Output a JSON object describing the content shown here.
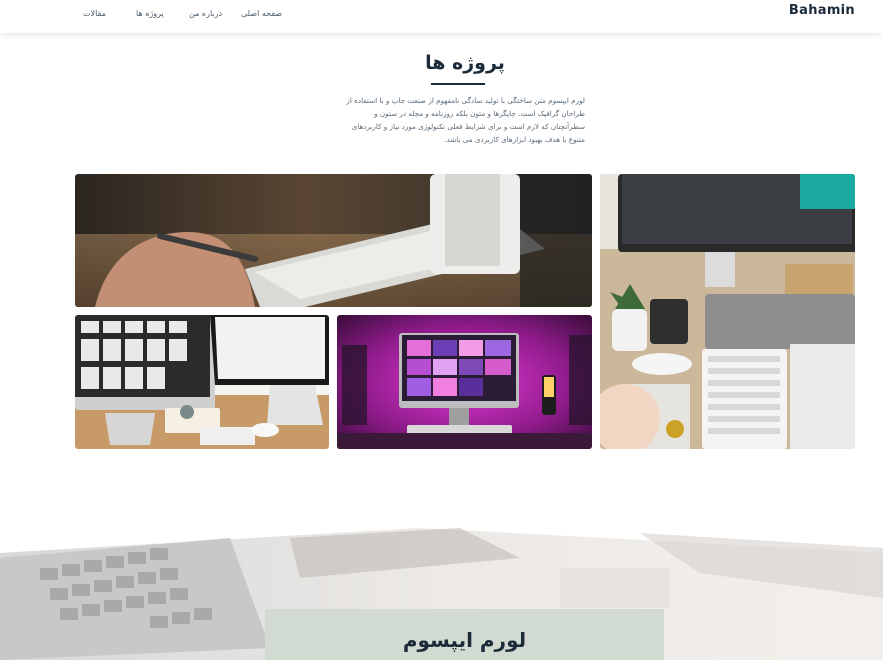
{
  "header": {
    "brand": "Bahamin",
    "nav": [
      {
        "label": "مقالات"
      },
      {
        "label": "پروژه ها"
      },
      {
        "label": "درباره من"
      },
      {
        "label": "صفحه اصلی"
      }
    ]
  },
  "projects": {
    "title": "پروژه ها",
    "intro": "لورم ایپسوم متن ساختگی با تولید سادگی نامفهوم از صنعت چاپ و با استفاده از طراحان گرافیک است. چاپگرها و متون بلکه روزنامه و مجله در ستون و سطرآنچنان که لازم است و برای شرایط فعلی تکنولوژی مورد نیاز و کاربردهای متنوع با هدف بهبود ابزارهای کاربردی می باشد."
  },
  "banner": {
    "card_title": "لورم ایپسوم"
  },
  "colors": {
    "heading": "#1c2b3a",
    "card_bg": "#d2dbd1",
    "accent_magenta": "#c21fb5"
  }
}
